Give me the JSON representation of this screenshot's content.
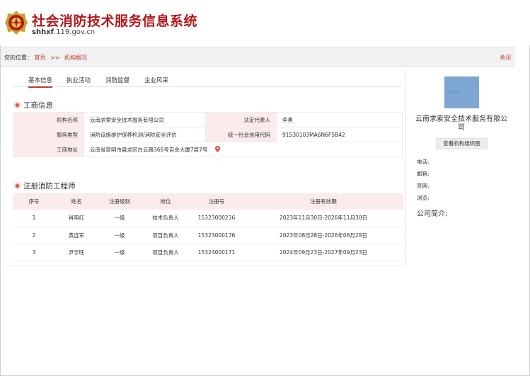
{
  "header": {
    "title": "社会消防技术服务信息系统",
    "url_bold": "shhxf",
    "url_rest": ".119.gov.cn"
  },
  "breadcrumb": {
    "prefix": "您的位置：",
    "home": "首页",
    "separator": ">>",
    "current": "机构概况",
    "close": "关闭"
  },
  "tabs": [
    "基本信息",
    "执业活动",
    "消防监督",
    "企业风采"
  ],
  "business": {
    "section_title": "工商信息",
    "rows": [
      {
        "k1": "机构名称",
        "v1": "云南求索安全技术服务有限公司",
        "k2": "法定代表人",
        "v2": "李勇"
      },
      {
        "k1": "服务类型",
        "v1": "消防设施维护保养检测/消防安全评估",
        "k2": "统一社会信用代码",
        "v2": "91530103MA6N6F5B42"
      }
    ],
    "address_label": "工商地址",
    "address": "云南省昆明市盘龙区白云路366号百金大厦7层7号"
  },
  "engineers": {
    "section_title": "注册消防工程师",
    "columns": [
      "序号",
      "姓名",
      "注册级别",
      "岗位",
      "注册号",
      "注册有效期"
    ],
    "rows": [
      [
        "1",
        "肖明红",
        "一级",
        "技术负责人",
        "15323000236",
        "2023年11月30日-2026年11月30日"
      ],
      [
        "2",
        "黄连军",
        "一级",
        "项目负责人",
        "15323000176",
        "2023年08月28日-2026年08月28日"
      ],
      [
        "3",
        "尹学旺",
        "一级",
        "项目负责人",
        "15324000171",
        "2024年09月23日-2027年09月23日"
      ]
    ]
  },
  "side": {
    "thumb_caption": "组织机构",
    "company_name": "云南求索安全技术服务有限公司",
    "org_button": "查看机构组织图",
    "phone_label": "电话:",
    "email_label": "邮箱:",
    "website_label": "官网:",
    "views_label": "浏览:",
    "intro_label": "公司简介:"
  },
  "colors": {
    "brand_red": "#b3191e",
    "link_red": "#c0392b",
    "label_bg": "#fbeceb",
    "thumb_blue": "#7ea6d3"
  }
}
